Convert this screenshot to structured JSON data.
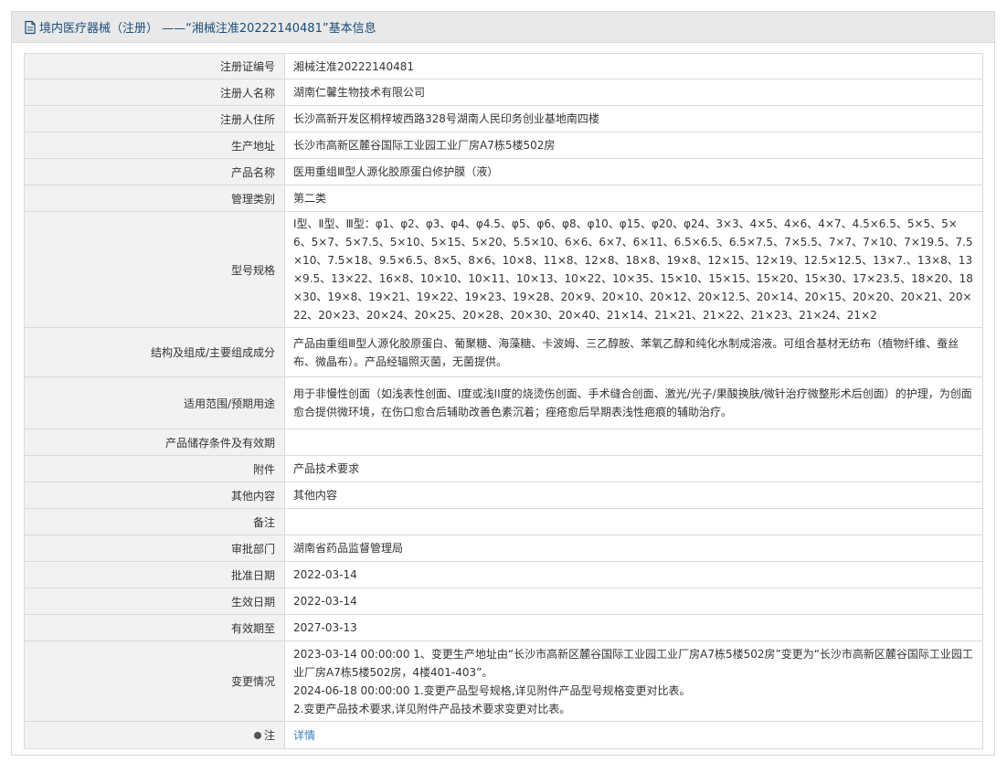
{
  "header": {
    "title": "境内医疗器械（注册） ——“湘械注准20222140481”基本信息"
  },
  "fields": {
    "reg_no": {
      "label": "注册证编号",
      "value": "湘械注准20222140481"
    },
    "registrant": {
      "label": "注册人名称",
      "value": "湖南仁馨生物技术有限公司"
    },
    "registrant_address": {
      "label": "注册人住所",
      "value": "长沙高新开发区桐梓坡西路328号湖南人民印务创业基地南四楼"
    },
    "production_address": {
      "label": "生产地址",
      "value": "长沙市高新区麓谷国际工业园工业厂房A7栋5楼502房"
    },
    "product_name": {
      "label": "产品名称",
      "value": "医用重组Ⅲ型人源化胶原蛋白修护膜（液）"
    },
    "category": {
      "label": "管理类别",
      "value": "第二类"
    },
    "spec": {
      "label": "型号规格",
      "value": "Ⅰ型、Ⅱ型、Ⅲ型：φ1、φ2、φ3、φ4、φ4.5、φ5、φ6、φ8、φ10、φ15、φ20、φ24、3×3、4×5、4×6、4×7、4.5×6.5、5×5、5×6、5×7、5×7.5、5×10、5×15、5×20、5.5×10、6×6、6×7、6×11、6.5×6.5、6.5×7.5、7×5.5、7×7、7×10、7×19.5、7.5×10、7.5×18、9.5×6.5、8×5、8×6、10×8、11×8、12×8、18×8、19×8、12×15、12×19、12.5×12.5、13×7.、13×8、13×9.5、13×22、16×8、10×10、10×11、10×13、10×22、10×35、15×10、15×15、15×20、15×30、17×23.5、18×20、18×30、19×8、19×21、19×22、19×23、19×28、20×9、20×10、20×12、20×12.5、20×14、20×15、20×20、20×21、20×22、20×23、20×24、20×25、20×28、20×30、20×40、21×14、21×21、21×22、21×23、21×24、21×2"
    },
    "composition": {
      "label": "结构及组成/主要组成成分",
      "value": "产品由重组Ⅲ型人源化胶原蛋白、葡聚糖、海藻糖、卡波姆、三乙醇胺、苯氧乙醇和纯化水制成溶液。可组合基材无纺布（植物纤维、蚕丝布、微晶布）。产品经辐照灭菌，无菌提供。"
    },
    "scope": {
      "label": "适用范围/预期用途",
      "value": "用于非慢性创面（如浅表性创面、I度或浅II度的烧烫伤创面、手术缝合创面、激光/光子/果酸换肤/微针治疗微整形术后创面）的护理，为创面愈合提供微环境，在伤口愈合后辅助改善色素沉着；痤疮愈后早期表浅性疤痕的辅助治疗。"
    },
    "storage": {
      "label": "产品储存条件及有效期",
      "value": ""
    },
    "attachment": {
      "label": "附件",
      "value": "产品技术要求"
    },
    "other": {
      "label": "其他内容",
      "value": "其他内容"
    },
    "remark": {
      "label": "备注",
      "value": ""
    },
    "approval_dept": {
      "label": "审批部门",
      "value": "湖南省药品监督管理局"
    },
    "approval_date": {
      "label": "批准日期",
      "value": "2022-03-14"
    },
    "effective_date": {
      "label": "生效日期",
      "value": "2022-03-14"
    },
    "expiry": {
      "label": "有效期至",
      "value": "2027-03-13"
    },
    "changes": {
      "label": "变更情况",
      "lines": [
        "2023-03-14 00:00:00 1、变更生产地址由“长沙市高新区麓谷国际工业园工业厂房A7栋5楼502房”变更为“长沙市高新区麓谷国际工业园工业厂房A7栋5楼502房，4楼401-403”。",
        "2024-06-18 00:00:00 1.变更产品型号规格,详见附件产品型号规格变更对比表。",
        "2.变更产品技术要求,详见附件产品技术要求变更对比表。"
      ]
    },
    "note": {
      "label": "注",
      "link": "详情",
      "icon": "location-pin-icon"
    }
  }
}
